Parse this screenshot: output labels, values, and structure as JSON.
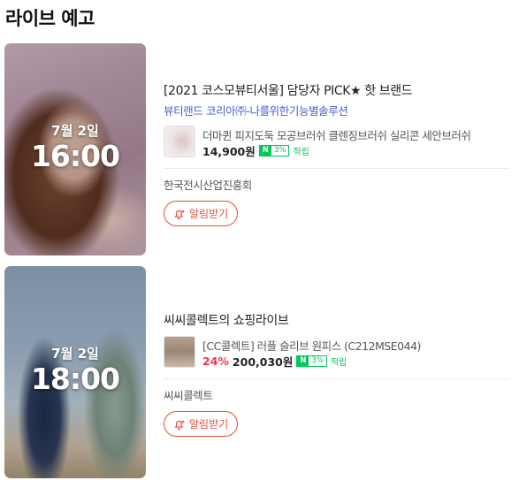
{
  "section_title": "라이브 예고",
  "colors": {
    "accent": "#e8503a",
    "brand_link": "#4a5ed1",
    "naverpay_green": "#03c75a",
    "discount_red": "#f0364a"
  },
  "icons": {
    "alarm": "bell-plus-icon"
  },
  "lives": [
    {
      "date": "7월 2일",
      "time": "16:00",
      "title": "[2021 코스모뷰티서울] 담당자 PICK★ 핫 브랜드",
      "brands": "뷰티랜드 코리아㈜-나를위한기능별솔루션",
      "product": {
        "name": "더마퀸 피지도둑 모공브러쉬 클렌징브러쉬 실리콘 세안브러쉬",
        "discount": "",
        "price": "14,900원",
        "npay_badge": "N",
        "npay_rate": "3%",
        "earn_label": "적립"
      },
      "seller": "한국전시산업진흥회",
      "alarm_label": "알림받기"
    },
    {
      "date": "7월 2일",
      "time": "18:00",
      "title": "씨씨콜렉트의 쇼핑라이브",
      "brands": "",
      "product": {
        "name": "[CC콜렉트] 러플 슬리브 원피스 (C212MSE044)",
        "discount": "24%",
        "price": "200,030원",
        "npay_badge": "N",
        "npay_rate": "3%",
        "earn_label": "적립"
      },
      "seller": "씨씨콜렉트",
      "alarm_label": "알림받기"
    }
  ]
}
